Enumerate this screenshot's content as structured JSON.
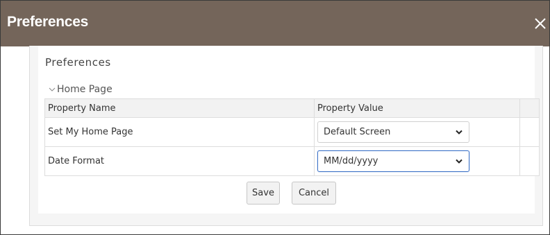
{
  "dialog": {
    "title": "Preferences",
    "close_icon": "close-icon"
  },
  "panel": {
    "title": "Preferences",
    "section": {
      "label": "Home Page",
      "expanded": true,
      "icon": "chevron-down-icon"
    }
  },
  "table": {
    "columns": [
      "Property Name",
      "Property Value"
    ],
    "rows": [
      {
        "name": "Set My Home Page",
        "value": "Default Screen"
      },
      {
        "name": "Date Format",
        "value": "MM/dd/yyyy"
      }
    ]
  },
  "buttons": {
    "save_label": "Save",
    "cancel_label": "Cancel"
  },
  "colors": {
    "titlebar": "#74655a",
    "focus_border": "#3f74c8"
  }
}
